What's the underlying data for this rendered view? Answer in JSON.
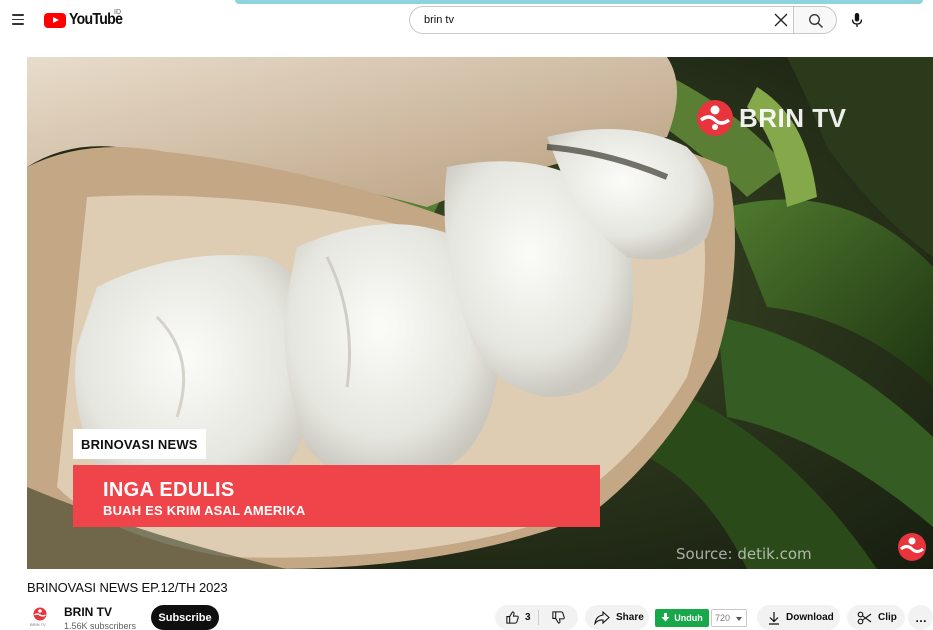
{
  "header": {
    "logo_text": "YouTube",
    "country_code": "ID",
    "search": {
      "value": "brin tv"
    },
    "icons": [
      "menu-icon",
      "clear-icon",
      "search-icon",
      "microphone-icon"
    ]
  },
  "player": {
    "watermark_text": "BRIN TV",
    "segment_tag": "BRINOVASI NEWS",
    "headline": "INGA EDULIS",
    "subheadline": "BUAH ES KRIM ASAL AMERIKA",
    "source": "Source: detik.com",
    "brand_color": "#ef4449"
  },
  "video": {
    "title": "BRINOVASI NEWS EP.12/TH 2023",
    "channel": {
      "name": "BRIN TV",
      "avatar_label": "BRIN TV",
      "subscribers": "1.56K subscribers"
    },
    "subscribe_label": "Subscribe"
  },
  "actions": {
    "like_count": "3",
    "share_label": "Share",
    "unduh_label": "Unduh",
    "quality": "720",
    "download_label": "Download",
    "clip_label": "Clip",
    "more_label": "…"
  }
}
